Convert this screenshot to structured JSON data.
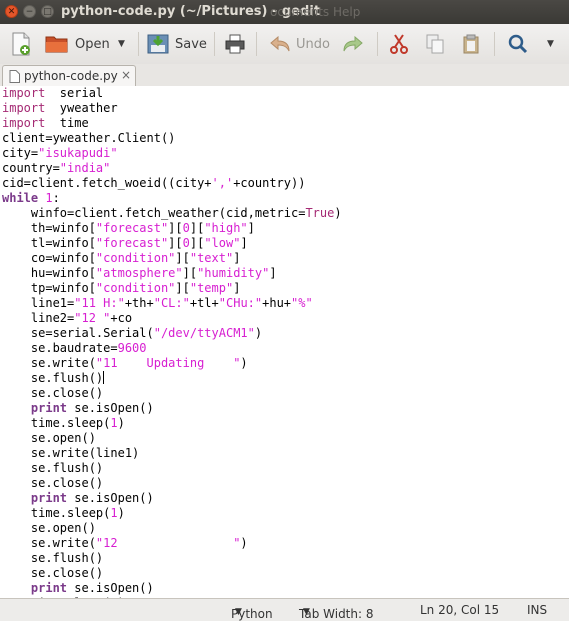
{
  "window": {
    "title": "python-code.py (~/Pictures) - gedit",
    "ghost_menu": "ocuments Help",
    "close_symbol": "✕",
    "minimize_symbol": "−",
    "maximize_symbol": "□"
  },
  "toolbar": {
    "open_label": "Open",
    "save_label": "Save",
    "undo_label": "Undo"
  },
  "tab": {
    "name": "python-code.py",
    "close_symbol": "×"
  },
  "code": {
    "cursor_line": 20,
    "lines": [
      [
        [
          "kw",
          "import"
        ],
        [
          "",
          "  serial"
        ]
      ],
      [
        [
          "kw",
          "import"
        ],
        [
          "",
          "  yweather"
        ]
      ],
      [
        [
          "kw",
          "import"
        ],
        [
          "",
          "  time"
        ]
      ],
      [
        [
          "",
          "client=yweather.Client()"
        ]
      ],
      [
        [
          "",
          "city="
        ],
        [
          "st",
          "\"isukapudi\""
        ]
      ],
      [
        [
          "",
          "country="
        ],
        [
          "st",
          "\"india\""
        ]
      ],
      [
        [
          "",
          "cid=client.fetch_woeid((city+"
        ],
        [
          "st",
          "','"
        ],
        [
          "",
          "+country))"
        ]
      ],
      [
        [
          "kwb",
          "while"
        ],
        [
          "",
          " "
        ],
        [
          "nm",
          "1"
        ],
        [
          "",
          ":"
        ]
      ],
      [
        [
          "",
          "    winfo=client.fetch_weather(cid,metric="
        ],
        [
          "kw",
          "True"
        ],
        [
          "",
          ")"
        ]
      ],
      [
        [
          "",
          "    th=winfo["
        ],
        [
          "st",
          "\"forecast\""
        ],
        [
          "",
          "]["
        ],
        [
          "nm",
          "0"
        ],
        [
          "",
          "]["
        ],
        [
          "st",
          "\"high\""
        ],
        [
          "",
          "]"
        ]
      ],
      [
        [
          "",
          "    tl=winfo["
        ],
        [
          "st",
          "\"forecast\""
        ],
        [
          "",
          "]["
        ],
        [
          "nm",
          "0"
        ],
        [
          "",
          "]["
        ],
        [
          "st",
          "\"low\""
        ],
        [
          "",
          "]"
        ]
      ],
      [
        [
          "",
          "    co=winfo["
        ],
        [
          "st",
          "\"condition\""
        ],
        [
          "",
          "]["
        ],
        [
          "st",
          "\"text\""
        ],
        [
          "",
          "]"
        ]
      ],
      [
        [
          "",
          "    hu=winfo["
        ],
        [
          "st",
          "\"atmosphere\""
        ],
        [
          "",
          "]["
        ],
        [
          "st",
          "\"humidity\""
        ],
        [
          "",
          "]"
        ]
      ],
      [
        [
          "",
          "    tp=winfo["
        ],
        [
          "st",
          "\"condition\""
        ],
        [
          "",
          "]["
        ],
        [
          "st",
          "\"temp\""
        ],
        [
          "",
          "]"
        ]
      ],
      [
        [
          "",
          "    line1="
        ],
        [
          "st",
          "\"11 H:\""
        ],
        [
          "",
          "+th+"
        ],
        [
          "st",
          "\"CL:\""
        ],
        [
          "",
          "+tl+"
        ],
        [
          "st",
          "\"CHu:\""
        ],
        [
          "",
          "+hu+"
        ],
        [
          "st",
          "\"%\""
        ]
      ],
      [
        [
          "",
          "    line2="
        ],
        [
          "st",
          "\"12 \""
        ],
        [
          "",
          "+co"
        ]
      ],
      [
        [
          "",
          "    se=serial.Serial("
        ],
        [
          "st",
          "\"/dev/ttyACM1\""
        ],
        [
          "",
          ")"
        ]
      ],
      [
        [
          "",
          "    se.baudrate="
        ],
        [
          "nm",
          "9600"
        ]
      ],
      [
        [
          "",
          "    se.write("
        ],
        [
          "st",
          "\"11    Updating    \""
        ],
        [
          "",
          ")"
        ]
      ],
      [
        [
          "",
          "    se.flush()"
        ],
        [
          "cursor",
          ""
        ]
      ],
      [
        [
          "",
          "    se.close()"
        ]
      ],
      [
        [
          "",
          "    "
        ],
        [
          "kwb",
          "print"
        ],
        [
          "",
          " se.isOpen()"
        ]
      ],
      [
        [
          "",
          "    time.sleep("
        ],
        [
          "nm",
          "1"
        ],
        [
          "",
          ")"
        ]
      ],
      [
        [
          "",
          "    se.open()"
        ]
      ],
      [
        [
          "",
          "    se.write(line1)"
        ]
      ],
      [
        [
          "",
          "    se.flush()"
        ]
      ],
      [
        [
          "",
          "    se.close()"
        ]
      ],
      [
        [
          "",
          "    "
        ],
        [
          "kwb",
          "print"
        ],
        [
          "",
          " se.isOpen()"
        ]
      ],
      [
        [
          "",
          "    time.sleep("
        ],
        [
          "nm",
          "1"
        ],
        [
          "",
          ")"
        ]
      ],
      [
        [
          "",
          "    se.open()"
        ]
      ],
      [
        [
          "",
          "    se.write("
        ],
        [
          "st",
          "\"12                \""
        ],
        [
          "",
          ")"
        ]
      ],
      [
        [
          "",
          "    se.flush()"
        ]
      ],
      [
        [
          "",
          "    se.close()"
        ]
      ],
      [
        [
          "",
          "    "
        ],
        [
          "kwb",
          "print"
        ],
        [
          "",
          " se.isOpen()"
        ]
      ],
      [
        [
          "",
          "    time.sleep(1)"
        ]
      ]
    ]
  },
  "statusbar": {
    "language": "Python",
    "tab_width": "Tab Width: 8",
    "position": "Ln 20, Col 15",
    "mode": "INS"
  },
  "colors": {
    "keyword": "#a52a74",
    "string": "#d71fd1",
    "titlebar": "#3c3b37"
  }
}
